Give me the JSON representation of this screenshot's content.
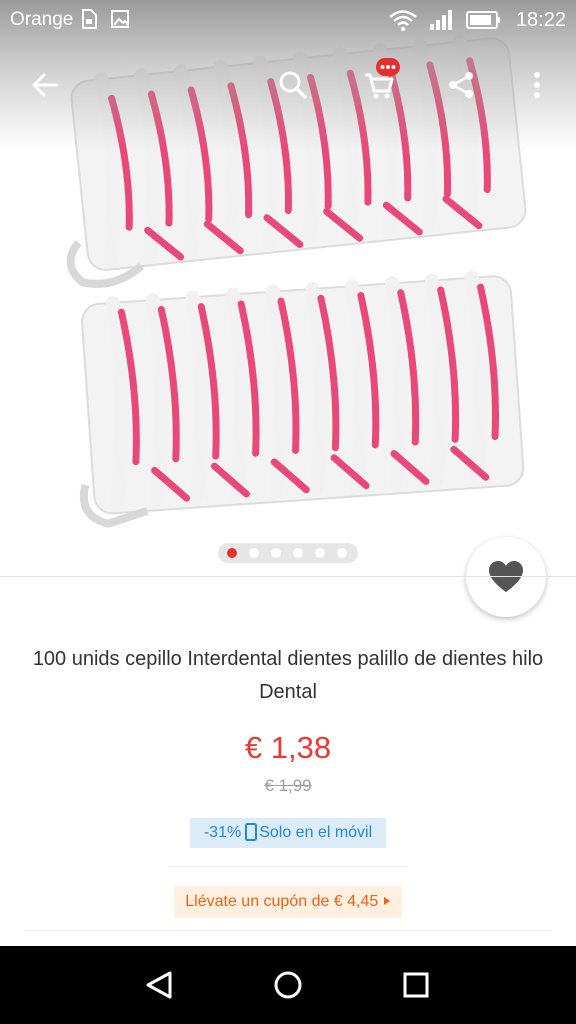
{
  "status_bar": {
    "carrier": "Orange",
    "time": "18:22",
    "icons": [
      "sim-icon",
      "image-icon",
      "wifi-icon",
      "signal-icon",
      "battery-icon"
    ]
  },
  "toolbar": {
    "icons": [
      "back-arrow-icon",
      "search-icon",
      "cart-icon",
      "share-icon",
      "more-vert-icon"
    ]
  },
  "carousel": {
    "total_images": 6,
    "active_index": 0
  },
  "product": {
    "title": "100 unids cepillo Interdental dientes palillo de dientes hilo Dental",
    "price": "€ 1,38",
    "original_price": "€ 1,99",
    "mobile_discount": {
      "percent": "-31%",
      "label": "Solo en el móvil"
    },
    "coupon_label": "Llévate un cupón de € 4,45"
  },
  "nav_bar": {
    "icons": [
      "nav-back-icon",
      "nav-home-icon",
      "nav-recents-icon"
    ]
  },
  "colors": {
    "price": "#e53935",
    "discount_text": "#1e88e5",
    "discount_bg": "#dcecf9",
    "coupon_text": "#e8631b",
    "coupon_bg": "#fff0e0",
    "active_dot": "#e62e2e",
    "floss_accent": "#e8497a"
  }
}
